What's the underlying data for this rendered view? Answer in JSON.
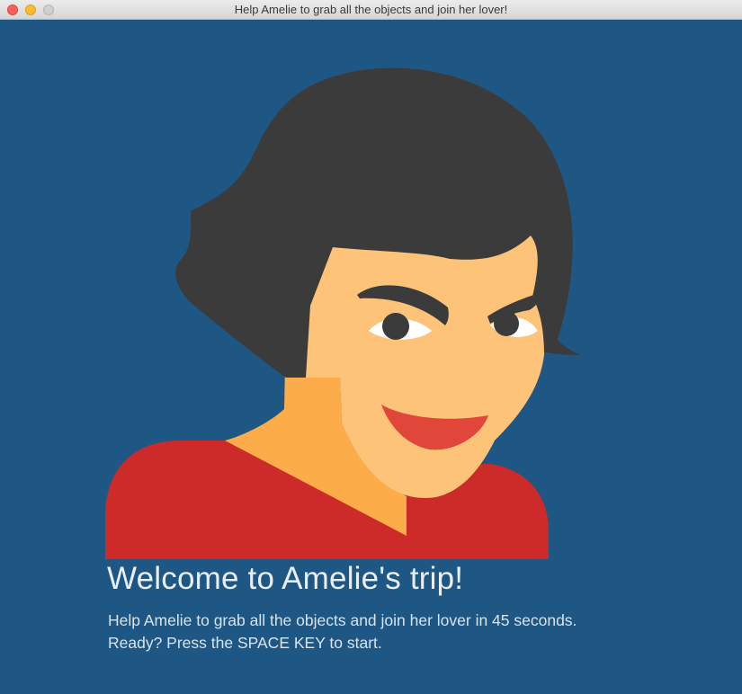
{
  "window": {
    "title": "Help Amelie to grab all the objects and join her lover!"
  },
  "welcome": {
    "heading": "Welcome to Amelie's trip!",
    "line1": "Help Amelie to grab all the objects and join her lover in 45 seconds.",
    "line2": "Ready? Press the SPACE KEY to start."
  },
  "colors": {
    "background": "#1e5784",
    "hair": "#3b3b3b",
    "skin": "#fdc378",
    "neck": "#fcac49",
    "shirt": "#cc2b29",
    "lips": "#e0463a"
  }
}
